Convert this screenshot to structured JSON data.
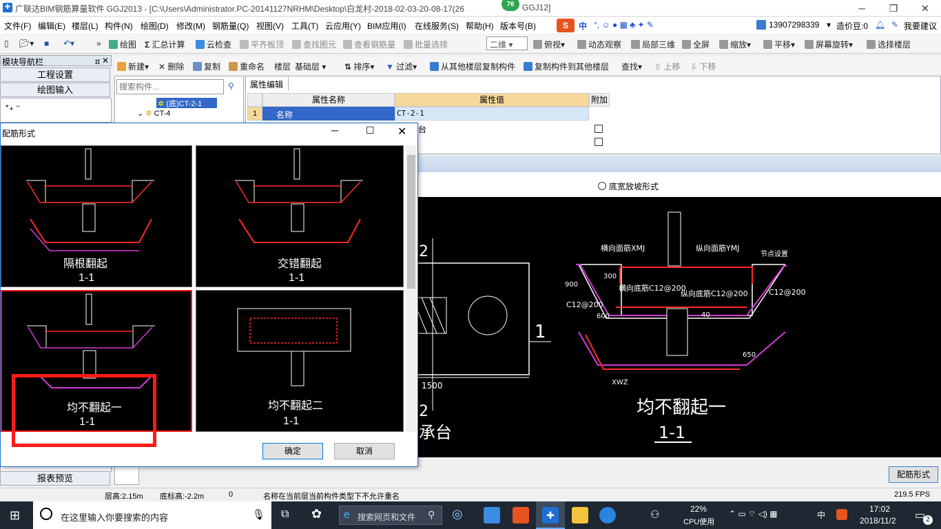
{
  "window": {
    "title": "广联达BIM钢筋算量软件 GGJ2013 - [C:\\Users\\Administrator.PC-20141127NRHM\\Desktop\\白龙村-2018-02-03-20-08-17(26",
    "title_suffix": "GGJ12]",
    "badge": "76"
  },
  "menu": [
    "文件(F)",
    "编辑(E)",
    "楼层(L)",
    "构件(N)",
    "绘图(D)",
    "修改(M)",
    "钢筋量(Q)",
    "视图(V)",
    "工具(T)",
    "云应用(Y)",
    "BIM应用(I)",
    "在线服务(S)",
    "帮助(H)",
    "版本号(B)"
  ],
  "menu_right": {
    "phone": "13907298339",
    "cost": "造价豆:0",
    "suggest": "我要建议",
    "ime_lang": "中"
  },
  "toolbar": [
    "绘图",
    "汇总计算",
    "云检查",
    "平齐板顶",
    "查找图元",
    "查看钢筋量",
    "批量选择",
    "二维",
    "俯视",
    "动态观察",
    "局部三维",
    "全屏",
    "缩放",
    "平移",
    "屏幕旋转",
    "选择楼层"
  ],
  "nav": {
    "title": "模块导航栏",
    "btn_project": "工程设置",
    "btn_draw": "绘图输入",
    "btn_report": "报表预览"
  },
  "toolbar2": [
    "新建",
    "删除",
    "复制",
    "重命名",
    "楼层",
    "基础层",
    "排序",
    "过滤",
    "从其他楼层复制构件",
    "复制构件到其他楼层",
    "查找",
    "上移",
    "下移"
  ],
  "tree": {
    "search_placeholder": "搜索构件...",
    "selected": "(底)CT-2-1",
    "item": "CT-4"
  },
  "props": {
    "tab": "属性编辑",
    "col_name": "属性名称",
    "col_value": "属性值",
    "col_extra": "附加",
    "row_num": "1",
    "row_name": "名称",
    "row_value": "CT-2-1",
    "row2_value": "台"
  },
  "dialog": {
    "title": "配筋形式",
    "options": [
      {
        "label": "隔根翻起",
        "section": "1-1"
      },
      {
        "label": "交错翻起",
        "section": "1-1"
      },
      {
        "label": "均不翻起一",
        "section": "1-1"
      },
      {
        "label": "均不翻起二",
        "section": "1-1"
      }
    ],
    "ok": "确定",
    "cancel": "取消"
  },
  "cad": {
    "radio_label": "底宽放坡形式",
    "title": "均不翻起一",
    "section": "1-1",
    "side_labels": {
      "num1": "1",
      "num2": "2",
      "num2b": "2",
      "dim": "1500",
      "cap": "承台"
    },
    "labels": {
      "xmj": "横向面筋XMJ",
      "ymj": "纵向面筋YMJ",
      "xdj": "横向底筋C12@200",
      "ydj": "纵向底筋C12@200",
      "side": "C12@200",
      "side_r": "C12@200",
      "h900": "900",
      "h300": "300",
      "h40": "40",
      "d600": "600",
      "d650": "650",
      "xwz": "XWZ",
      "node": "节点设置"
    },
    "btn": "配筋形式"
  },
  "status": {
    "floor_h": "层高:2.15m",
    "base_h": "底标高:-2.2m",
    "num": "0",
    "msg": "名称在当前层当前构件类型下不允许重名",
    "fps": "219.5 FPS"
  },
  "taskbar": {
    "search": "在这里输入你要搜索的内容",
    "browser_search": "搜索网页和文件",
    "cpu_pct": "22%",
    "cpu_label": "CPU使用",
    "lang": "中",
    "time": "17:02",
    "date": "2018/11/2",
    "notif": "2"
  }
}
